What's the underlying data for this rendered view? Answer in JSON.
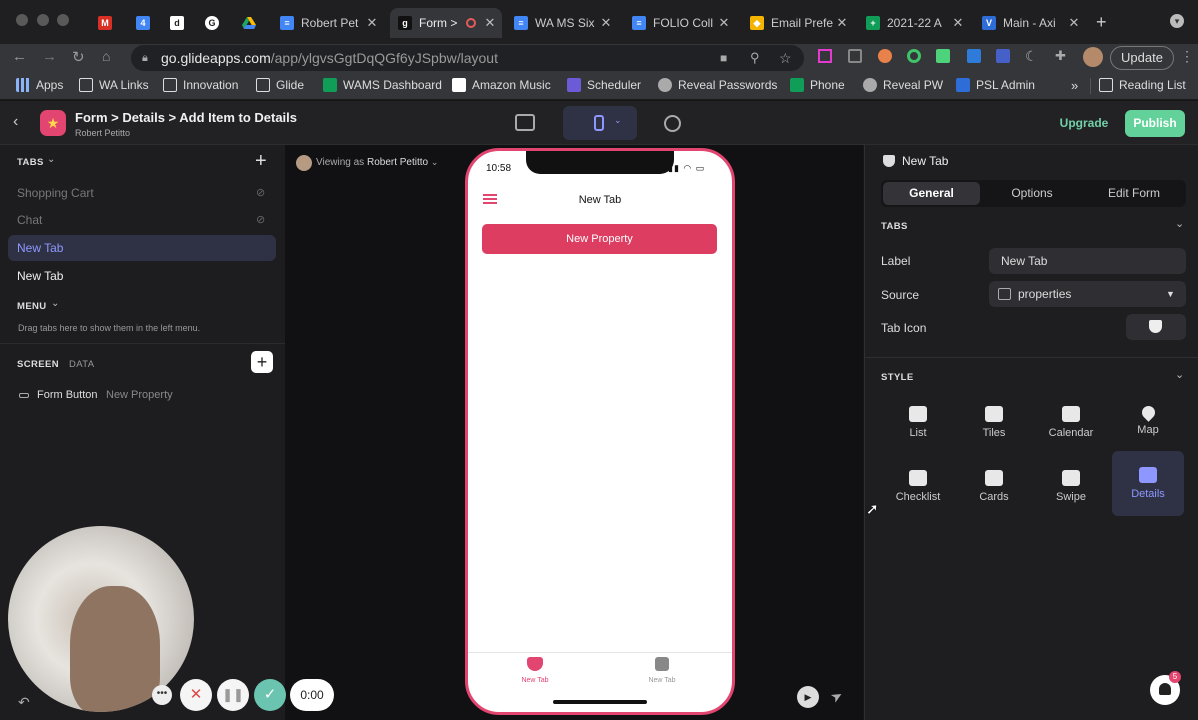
{
  "browser": {
    "tabs": [
      {
        "label": "",
        "icon": "gmail-icon",
        "color": "#d93025"
      },
      {
        "label": "",
        "icon": "calendar-icon",
        "color": "#4285f4"
      },
      {
        "label": "",
        "icon": "d-icon",
        "color": "#333333"
      },
      {
        "label": "",
        "icon": "g-icon",
        "color": "#333333"
      },
      {
        "label": "",
        "icon": "drive-icon",
        "color": "#1fa463"
      },
      {
        "label": "Robert Pet",
        "icon": "docs-icon",
        "color": "#4285f4"
      },
      {
        "label": "Form >",
        "icon": "glide-icon",
        "color": "#222222"
      },
      {
        "label": "WA MS Six",
        "icon": "docs-icon",
        "color": "#4285f4"
      },
      {
        "label": "FOLIO Coll",
        "icon": "docs-icon",
        "color": "#4285f4"
      },
      {
        "label": "Email Prefe",
        "icon": "email-icon",
        "color": "#f4b400"
      },
      {
        "label": "2021-22 A",
        "icon": "sheets-icon",
        "color": "#0f9d58"
      },
      {
        "label": "Main - Axi",
        "icon": "v-icon",
        "color": "#2e6dd8"
      }
    ],
    "url_main": "go.glideapps.com",
    "url_path": "/app/ylgvsGgtDqQGf6yJSpbw/layout",
    "update_label": "Update",
    "bookmarks": [
      "Apps",
      "WA Links",
      "Innovation",
      "Glide",
      "WAMS Dashboard",
      "Amazon Music",
      "Scheduler",
      "Reveal Passwords",
      "Phone",
      "Reveal PW",
      "PSL Admin"
    ],
    "overflow": "»",
    "reading_list": "Reading List"
  },
  "header": {
    "breadcrumb": "Form > Details > Add Item to Details",
    "user": "Robert Petitto",
    "upgrade": "Upgrade",
    "publish": "Publish"
  },
  "left": {
    "tabs_title": "TABS",
    "tabs": [
      {
        "label": "Shopping Cart",
        "hidden": true
      },
      {
        "label": "Chat",
        "hidden": true
      },
      {
        "label": "New Tab",
        "hidden": false,
        "selected": true
      },
      {
        "label": "New Tab",
        "hidden": false,
        "selected": false
      }
    ],
    "menu_title": "MENU",
    "menu_hint": "Drag tabs here to show them in the left menu.",
    "screen_tab": "SCREEN",
    "data_tab": "DATA",
    "component_type": "Form Button",
    "component_label": "New Property"
  },
  "canvas": {
    "viewing_as": "Viewing as",
    "viewing_user": "Robert Petitto",
    "phone": {
      "time": "10:58",
      "title": "New Tab",
      "button": "New Property",
      "nav": [
        "New Tab",
        "New Tab"
      ]
    }
  },
  "right": {
    "title": "New Tab",
    "tabs": [
      "General",
      "Options",
      "Edit Form"
    ],
    "tabs_section": "TABS",
    "label_label": "Label",
    "label_value": "New Tab",
    "source_label": "Source",
    "source_value": "properties",
    "icon_label": "Tab Icon",
    "style_section": "STYLE",
    "styles": [
      "List",
      "Tiles",
      "Calendar",
      "Map",
      "Checklist",
      "Cards",
      "Swipe",
      "Details"
    ],
    "selected_style": "Details",
    "notifications": "5"
  },
  "recorder": {
    "timer": "0:00"
  },
  "colors": {
    "accent": "#e2456f",
    "publish": "#62d29a",
    "selected": "#2f3244",
    "selectedText": "#8d97ff"
  }
}
